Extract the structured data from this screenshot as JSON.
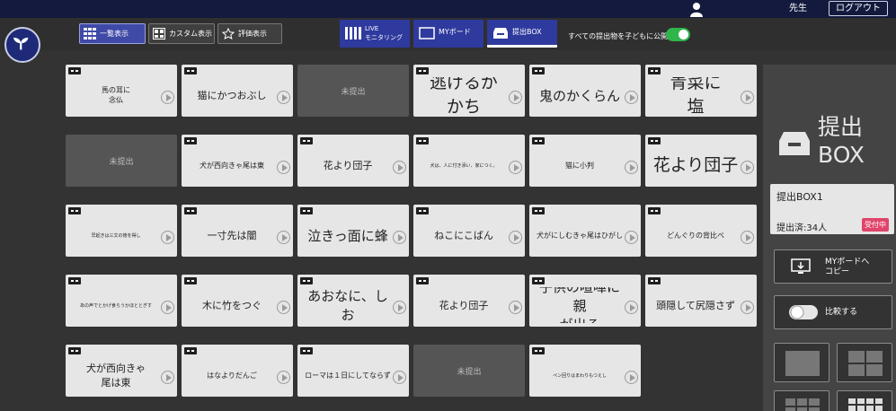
{
  "topbar": {
    "teacher_label": "先生",
    "logout_label": "ログアウト"
  },
  "toolbar": {
    "view_list": "一覧表示",
    "view_custom": "カスタム表示",
    "view_rating": "評価表示",
    "nav_live_line1": "LIVE",
    "nav_live_line2": "モニタリング",
    "nav_myboard": "MYボード",
    "nav_submitbox": "提出BOX",
    "publish_label": "すべての提出物を子どもに公開",
    "publish_enabled": true,
    "accent_color": "#2fb54a"
  },
  "grid": [
    [
      {
        "text": "馬の耳に\n念仏",
        "size": "s"
      },
      {
        "text": "猫にかつおぶし",
        "size": "m"
      },
      {
        "empty": true,
        "text": "未提出"
      },
      {
        "text": "逃げるが\nかち",
        "size": "xl"
      },
      {
        "text": "鬼のかくらん",
        "size": "l"
      },
      {
        "text": "青菜に\n塩",
        "size": "xl"
      }
    ],
    [
      {
        "empty": true,
        "text": "未提出"
      },
      {
        "text": "犬が西向きゃ尾は東",
        "size": "s"
      },
      {
        "text": "花より団子",
        "size": "m"
      },
      {
        "text": "犬は、人に付き添い、家につく。",
        "size": "xs"
      },
      {
        "text": "猫に小判",
        "size": "s"
      },
      {
        "text": "花より団子",
        "size": "xl"
      }
    ],
    [
      {
        "text": "早起きは三文の徳を得し",
        "size": "xs"
      },
      {
        "text": "一寸先は闇",
        "size": "m"
      },
      {
        "text": "泣きっ面に蜂",
        "size": "l"
      },
      {
        "text": "ねこにこばん",
        "size": "m"
      },
      {
        "text": "犬がにしむきゃ尾はひがし",
        "size": "s"
      },
      {
        "text": "どんぐりの背比べ",
        "size": "s"
      }
    ],
    [
      {
        "text": "あの声でとかげ食らうかほととぎす",
        "size": "xs"
      },
      {
        "text": "木に竹をつぐ",
        "size": "m"
      },
      {
        "text": "あおなに、しお",
        "size": "l"
      },
      {
        "text": "花より団子",
        "size": "m"
      },
      {
        "text": "子供の喧嘩に親\nが出る",
        "size": "l"
      },
      {
        "text": "頭隠して尻隠さず",
        "size": "m"
      }
    ],
    [
      {
        "text": "犬が西向きゃ\n尾は東",
        "size": "m"
      },
      {
        "text": "はなよりだんご",
        "size": "s"
      },
      {
        "text": "ローマは１日にしてならず",
        "size": "s"
      },
      {
        "empty": true,
        "text": "未提出"
      },
      {
        "text": "ペン回りはまわりもつえし",
        "size": "xs"
      }
    ]
  ],
  "box": {
    "title_line1": "提出",
    "title_line2": "BOX",
    "name": "提出BOX1",
    "count": "提出済:34人",
    "status": "受付中",
    "status_color": "#e0446b"
  },
  "actions": {
    "myboard_copy": "MYボードへ\nコピー",
    "compare": "比較する"
  },
  "icons": [
    "user-icon",
    "grid-view-icon",
    "custom-view-icon",
    "rating-icon",
    "live-monitor-icon",
    "myboard-icon",
    "tray-icon",
    "board-copy-icon",
    "compare-toggle-icon",
    "layout-icon"
  ]
}
